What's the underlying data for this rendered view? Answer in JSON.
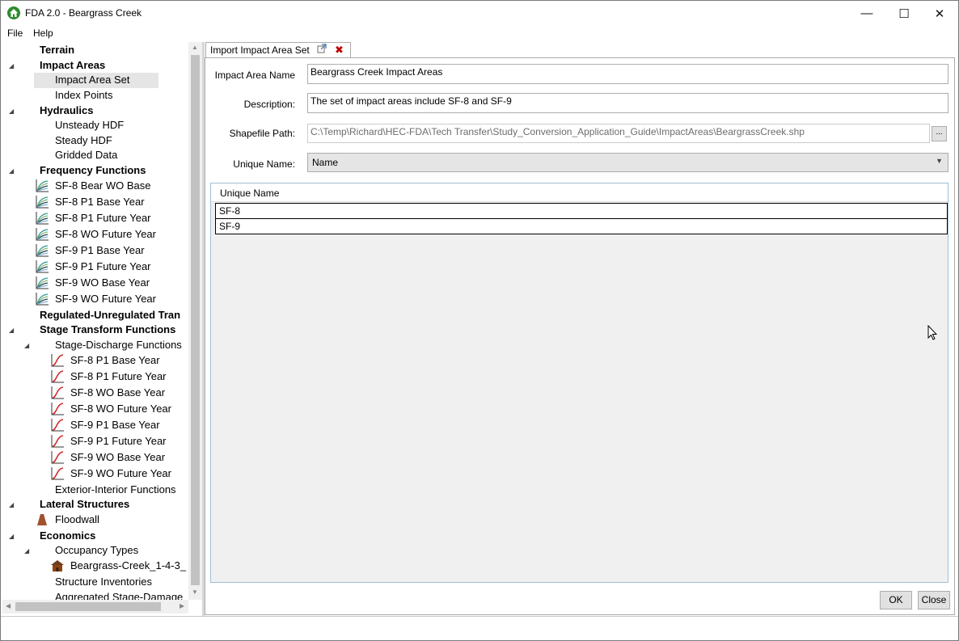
{
  "window": {
    "title": "FDA 2.0 - Beargrass Creek",
    "minimize": "—",
    "maximize": "☐",
    "close": "✕"
  },
  "menu": {
    "file": "File",
    "help": "Help"
  },
  "tree": {
    "terrain": "Terrain",
    "impact_areas": "Impact Areas",
    "impact_area_set": "Impact Area Set",
    "index_points": "Index Points",
    "hydraulics": "Hydraulics",
    "unsteady_hdf": "Unsteady HDF",
    "steady_hdf": "Steady HDF",
    "gridded_data": "Gridded Data",
    "frequency_functions": "Frequency Functions",
    "freq_items": [
      "SF-8 Bear WO Base",
      "SF-8 P1 Base Year",
      "SF-8 P1 Future Year",
      "SF-8 WO Future Year",
      "SF-9 P1 Base Year",
      "SF-9 P1 Future Year",
      "SF-9 WO Base Year",
      "SF-9 WO Future Year"
    ],
    "regulated_unregulated": "Regulated-Unregulated Tran",
    "stage_transform": "Stage Transform Functions",
    "stage_discharge": "Stage-Discharge Functions",
    "stage_items": [
      "SF-8 P1 Base Year",
      "SF-8 P1 Future Year",
      "SF-8 WO Base Year",
      "SF-8 WO Future Year",
      "SF-9 P1 Base Year",
      "SF-9 P1 Future Year",
      "SF-9 WO Base Year",
      "SF-9 WO Future Year"
    ],
    "exterior_interior": "Exterior-Interior Functions",
    "lateral_structures": "Lateral Structures",
    "floodwall": "Floodwall",
    "economics": "Economics",
    "occupancy_types": "Occupancy Types",
    "occupancy_item": "Beargrass-Creek_1-4-3_",
    "structure_inventories": "Structure Inventories",
    "aggregated": "Aggregated Stage-Damage"
  },
  "tab": {
    "label": "Import Impact Area Set"
  },
  "form": {
    "name_label": "Impact Area Name",
    "name_value": "Beargrass Creek Impact Areas",
    "desc_label": "Description:",
    "desc_value": "The set of impact areas include SF-8 and SF-9",
    "shapefile_label": "Shapefile Path:",
    "shapefile_value": "C:\\Temp\\Richard\\HEC-FDA\\Tech Transfer\\Study_Conversion_Application_Guide\\ImpactAreas\\BeargrassCreek.shp",
    "browse_label": "...",
    "unique_label": "Unique Name:",
    "unique_value": "Name"
  },
  "grid": {
    "header": "Unique Name",
    "rows": [
      "SF-8",
      "SF-9"
    ]
  },
  "buttons": {
    "ok": "OK",
    "close": "Close"
  },
  "colors": {
    "selection": "#e5e5e5",
    "app_icon": "#2e8b2e",
    "close_x": "#c00000"
  }
}
